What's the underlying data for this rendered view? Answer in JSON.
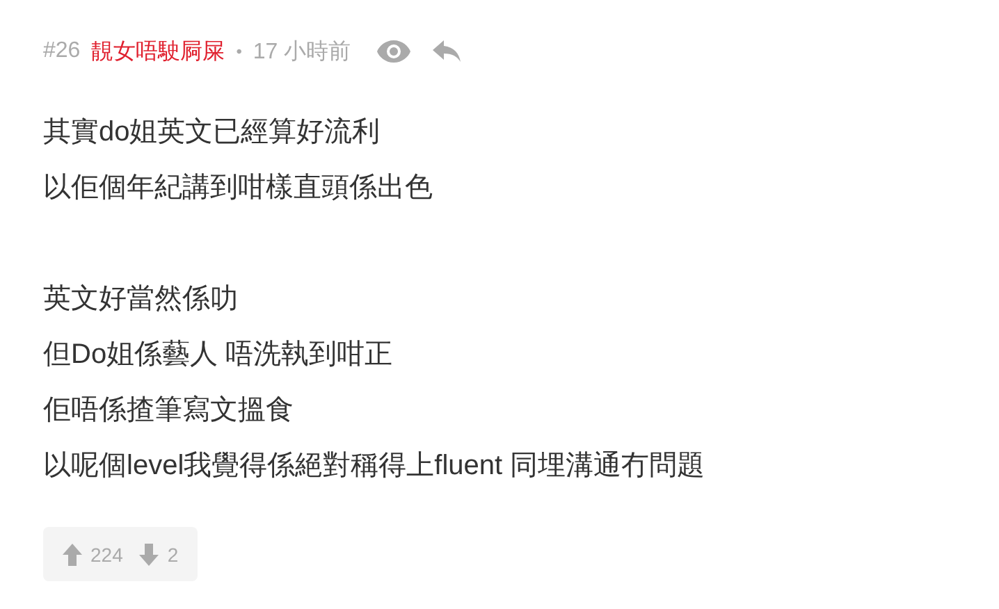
{
  "post": {
    "number": "#26",
    "author": "靚女唔駛屙屎",
    "separator": "•",
    "time": "17 小時前",
    "paragraphs": [
      [
        "其實do姐英文已經算好流利",
        "以佢個年紀講到咁樣直頭係出色"
      ],
      [
        "英文好當然係叻",
        "但Do姐係藝人 唔洗執到咁正",
        "佢唔係揸筆寫文搵食",
        "以呢個level我覺得係絕對稱得上fluent 同埋溝通冇問題"
      ]
    ],
    "upvotes": "224",
    "downvotes": "2"
  }
}
